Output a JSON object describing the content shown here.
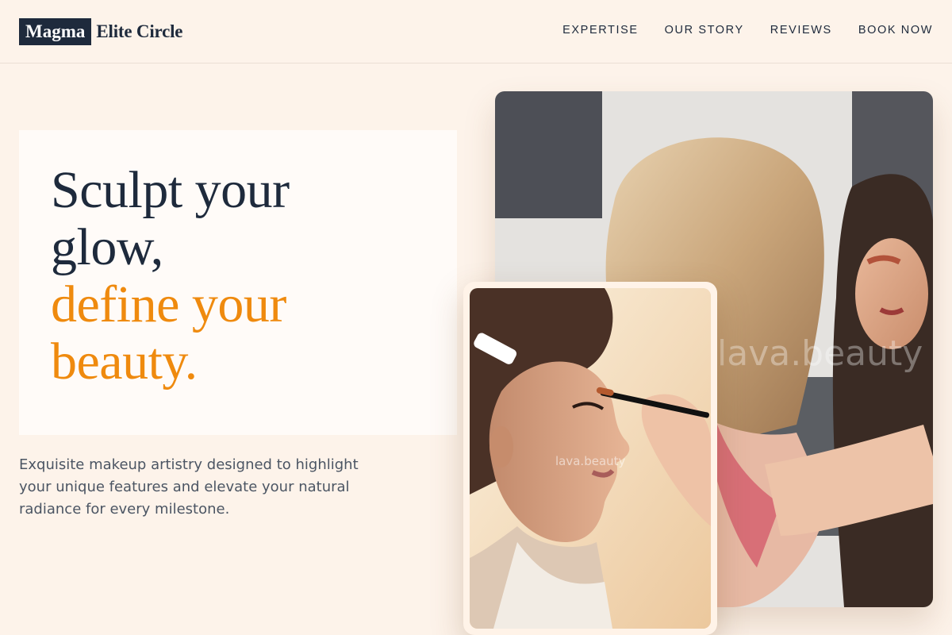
{
  "brand": {
    "box": "Magma",
    "name": "Elite Circle"
  },
  "nav": {
    "items": [
      "EXPERTISE",
      "OUR STORY",
      "REVIEWS",
      "BOOK NOW"
    ]
  },
  "hero": {
    "headline_dark_1": "Sculpt your",
    "headline_dark_2": "glow,",
    "headline_accent_1": "define your",
    "headline_accent_2": "beauty.",
    "description": "Exquisite makeup artistry designed to highlight your unique features and elevate your natural radiance for every milestone."
  },
  "images": {
    "main_watermark": "lava.beauty",
    "small_watermark": "lava.beauty"
  },
  "colors": {
    "background": "#fdf3ea",
    "navy": "#1e2a3c",
    "accent": "#ef8a0e"
  }
}
